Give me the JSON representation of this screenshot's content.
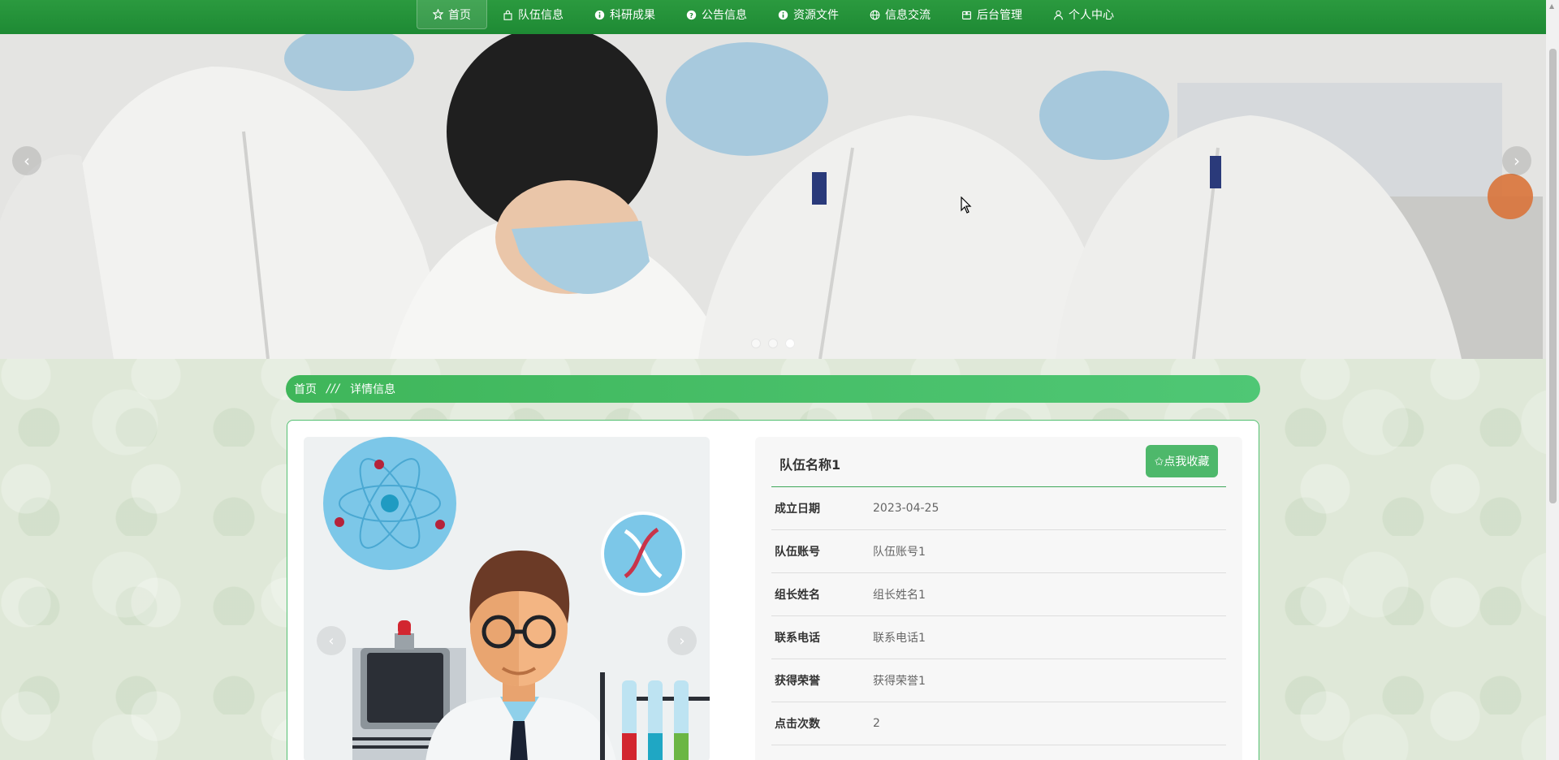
{
  "nav": {
    "items": [
      {
        "label": "首页",
        "icon": "star-icon"
      },
      {
        "label": "队伍信息",
        "icon": "bag-icon"
      },
      {
        "label": "科研成果",
        "icon": "info-icon"
      },
      {
        "label": "公告信息",
        "icon": "help-icon"
      },
      {
        "label": "资源文件",
        "icon": "info-icon"
      },
      {
        "label": "信息交流",
        "icon": "globe-icon"
      },
      {
        "label": "后台管理",
        "icon": "box-icon"
      },
      {
        "label": "个人中心",
        "icon": "user-icon"
      }
    ],
    "active": 0
  },
  "banner": {
    "prev": "‹",
    "next": "›",
    "slides": 3,
    "active_slide": 3
  },
  "breadcrumb": {
    "home": "首页",
    "separator": "///",
    "current": "详情信息"
  },
  "gallery": {
    "prev": "‹",
    "next": "›"
  },
  "detail": {
    "title": "队伍名称1",
    "favorite_label": "✩点我收藏",
    "fields": [
      {
        "label": "成立日期",
        "value": "2023-04-25"
      },
      {
        "label": "队伍账号",
        "value": "队伍账号1"
      },
      {
        "label": "组长姓名",
        "value": "组长姓名1"
      },
      {
        "label": "联系电话",
        "value": "联系电话1"
      },
      {
        "label": "获得荣誉",
        "value": "获得荣誉1"
      },
      {
        "label": "点击次数",
        "value": "2"
      }
    ]
  },
  "colors": {
    "nav": "#1e8a34",
    "accent": "#4eb86b",
    "breadcrumb": "#3fb65a"
  }
}
